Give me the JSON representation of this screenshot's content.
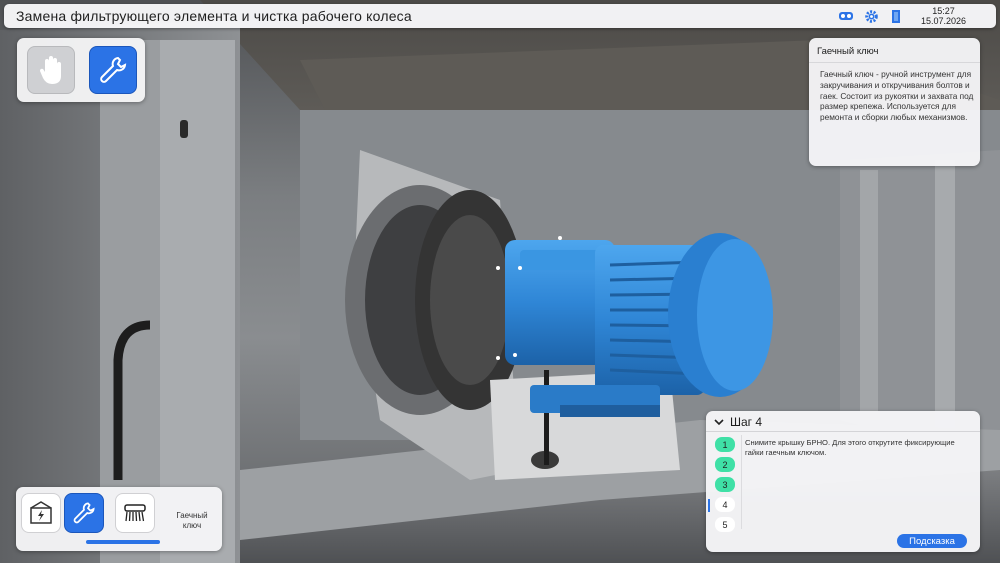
{
  "window": {
    "title": "Замена фильтрующего элемента и чистка рабочего колеса"
  },
  "header": {
    "icons": [
      "vr-headset-icon",
      "gear-icon",
      "exit-door-icon"
    ],
    "time": "15:27",
    "date": "15.07.2026"
  },
  "tools": {
    "items": [
      {
        "name": "hand-tool",
        "icon": "hand-icon",
        "active": false
      },
      {
        "name": "wrench-tool",
        "icon": "wrench-icon",
        "active": true
      }
    ]
  },
  "info": {
    "title": "Гаечный ключ",
    "description": "Гаечный ключ - ручной инструмент для закручивания и откручивания болтов и гаек. Состоит из рукоятки и захвата под размер крепежа. Используется для ремонта и сборки любых механизмов."
  },
  "inventory": {
    "items": [
      {
        "icon": "electrical-panel-icon",
        "selected": false
      },
      {
        "icon": "wrench-icon",
        "selected": true
      },
      {
        "icon": "brush-icon",
        "selected": false
      }
    ],
    "selected_label": "Гаечный ключ"
  },
  "steps": {
    "title": "Шаг 4",
    "numbers": [
      "1",
      "2",
      "3",
      "4",
      "5"
    ],
    "completed": 3,
    "current": 4,
    "instruction": "Снимите крышку БРНО. Для этого открутите фиксирующие гайки гаечным ключом.",
    "hint_button": "Подсказка"
  },
  "colors": {
    "accent": "#2b73e6",
    "done": "#3fe0a6",
    "motor": "#2f86d6"
  }
}
